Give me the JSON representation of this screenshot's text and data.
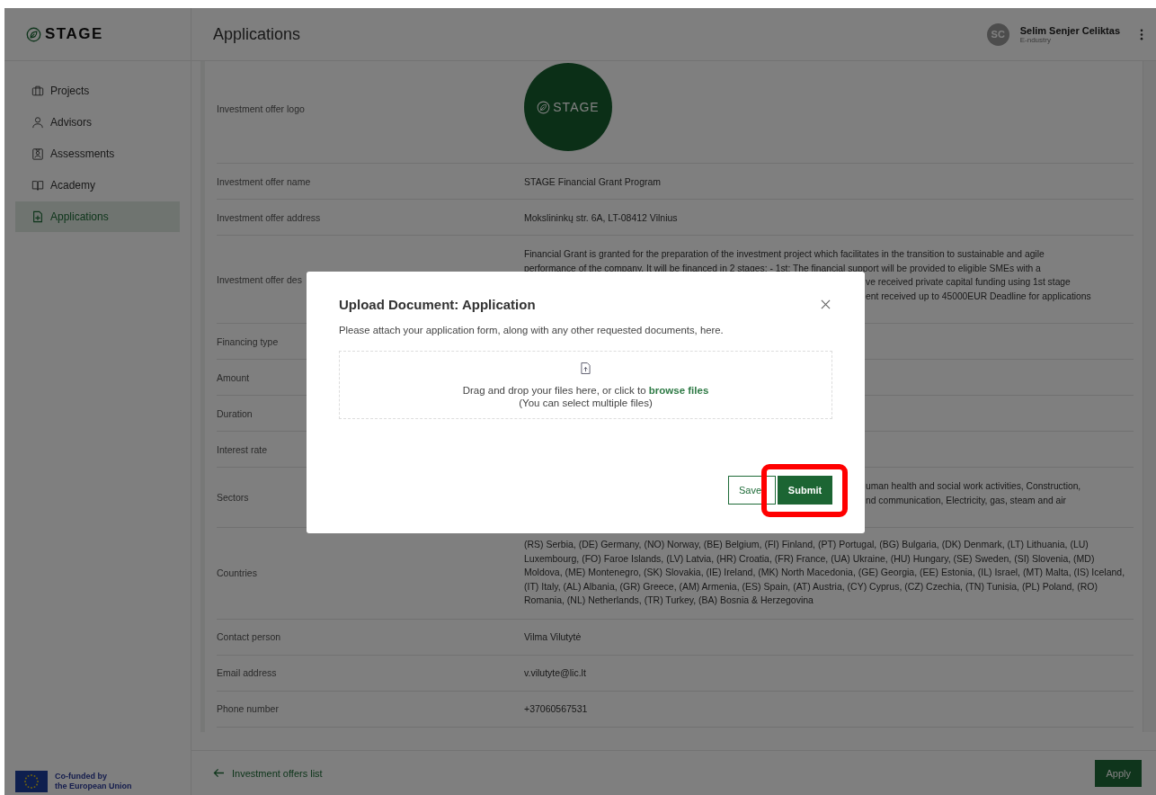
{
  "brand": "STAGE",
  "header": {
    "title": "Applications",
    "user": {
      "initials": "SC",
      "name": "Selim Senjer Celiktas",
      "company": "E-ndustry"
    }
  },
  "sidebar": {
    "items": [
      {
        "label": "Projects",
        "kind": "briefcase",
        "selected": false
      },
      {
        "label": "Advisors",
        "kind": "person",
        "selected": false
      },
      {
        "label": "Assessments",
        "kind": "badge",
        "selected": false
      },
      {
        "label": "Academy",
        "kind": "book",
        "selected": false
      },
      {
        "label": "Applications",
        "kind": "file",
        "selected": true
      }
    ],
    "footer": [
      "Co-funded by",
      "the European Union"
    ]
  },
  "details": [
    {
      "kind": "logo",
      "label": "Investment offer logo",
      "logo_text": "STAGE"
    },
    {
      "kind": "text",
      "label": "Investment offer name",
      "value": "STAGE Financial Grant Program"
    },
    {
      "kind": "text",
      "label": "Investment offer address",
      "value": "Mokslininkų str. 6A, LT-08412 Vilnius"
    },
    {
      "kind": "lines",
      "label": "Investment offer des",
      "lines": [
        {
          "text": "Financial Grant is granted for the preparation of the investment project which facilitates in the transition to sustainable and agile",
          "kind": "full"
        },
        {
          "text": "performance of the company. It will be financed in 2 stages: - 1st: The financial support will be provided to eligible SMEs with a",
          "kind": "full"
        },
        {
          "text": "ve received private capital funding using 1st stage",
          "kind": "clipped"
        },
        {
          "text": "ent received up to 45000EUR Deadline for applications",
          "kind": "clipped"
        }
      ]
    },
    {
      "kind": "text",
      "label": "Financing type"
    },
    {
      "kind": "text",
      "label": "Amount"
    },
    {
      "kind": "text",
      "label": "Duration"
    },
    {
      "kind": "text",
      "label": "Interest rate"
    },
    {
      "kind": "lines",
      "label": "Sectors",
      "lines": [
        {
          "text": "uman health and social work activities, Construction,",
          "kind": "clipped"
        },
        {
          "text": "nd communication, Electricity, gas, steam and air",
          "kind": "clipped"
        }
      ]
    },
    {
      "kind": "paragraph",
      "label": "Countries",
      "value": "(RS) Serbia, (DE) Germany, (NO) Norway, (BE) Belgium, (FI) Finland, (PT) Portugal, (BG) Bulgaria, (DK) Denmark, (LT) Lithuania, (LU) Luxembourg, (FO) Faroe Islands, (LV) Latvia, (HR) Croatia, (FR) France, (UA) Ukraine, (HU) Hungary, (SE) Sweden, (SI) Slovenia, (MD) Moldova, (ME) Montenegro, (SK) Slovakia, (IE) Ireland, (MK) North Macedonia, (GE) Georgia, (EE) Estonia, (IL) Israel, (MT) Malta, (IS) Iceland, (IT) Italy, (AL) Albania, (GR) Greece, (AM) Armenia, (ES) Spain, (AT) Austria, (CY) Cyprus, (CZ) Czechia, (TN) Tunisia, (PL) Poland, (RO) Romania, (NL) Netherlands, (TR) Turkey, (BA) Bosnia & Herzegovina"
    },
    {
      "kind": "text",
      "label": "Contact person",
      "value": "Vilma Vilutytė"
    },
    {
      "kind": "text",
      "label": "Email address",
      "value": "v.vilutyte@lic.lt"
    },
    {
      "kind": "text",
      "label": "Phone number",
      "value": "+37060567531"
    }
  ],
  "footer": {
    "back_link": "Investment offers list",
    "apply": "Apply"
  },
  "modal": {
    "title": "Upload Document: Application",
    "message": "Please attach your application form, along with any other requested documents, here.",
    "dropzone": {
      "text": "Drag and drop your files here, or click to ",
      "link": "browse files",
      "hint": "(You can select multiple files)"
    },
    "buttons": [
      {
        "label": "Save",
        "kind": "outline",
        "highlighted": false
      },
      {
        "label": "Submit",
        "kind": "primary",
        "highlighted": true
      }
    ]
  }
}
